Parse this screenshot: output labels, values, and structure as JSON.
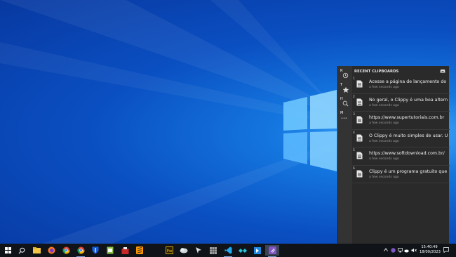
{
  "clippy": {
    "title": "RECENT CLIPBOARDS",
    "rail": [
      {
        "key": "R",
        "icon": "history-icon"
      },
      {
        "key": "T",
        "icon": "star-icon"
      },
      {
        "key": "H",
        "icon": "search-icon"
      },
      {
        "key": "M",
        "icon": "more-icon",
        "more": "•••"
      }
    ],
    "items": [
      {
        "num": "1",
        "text": "Acesse a página de lançamento do Cli",
        "time": "a few seconds ago"
      },
      {
        "num": "2",
        "text": "No geral, o Clippy é uma boa alternati",
        "time": "a few seconds ago"
      },
      {
        "num": "3",
        "text": "https://www.supertutoriais.com.br",
        "time": "a few seconds ago"
      },
      {
        "num": "4",
        "text": "O Clippy é muito simples de usar. Uma",
        "time": "a few seconds ago"
      },
      {
        "num": "5",
        "text": "https://www.softdownload.com.br/",
        "time": "a few seconds ago"
      },
      {
        "num": "6",
        "text": "Clippy é um programa gratuito que ofe",
        "time": "a few seconds ago"
      }
    ]
  },
  "taskbar": {
    "time": "15:40:49",
    "date": "18/09/2023",
    "apps": [
      "start-icon",
      "search-icon",
      "file-explorer-icon",
      "firefox-icon",
      "chrome-icon",
      "chrome-alt-icon",
      "bitwarden-icon",
      "notepad-icon",
      "app-red-icon",
      "sublime-icon",
      "dreamweaver-icon",
      "app-cloud-icon",
      "app-cursor-icon",
      "app-grid-icon",
      "vscode-icon",
      "app-teal-icon",
      "app-blue-icon",
      "clippy-icon"
    ]
  },
  "colors": {
    "accent": "#0a55c9",
    "panel": "#2a2a2a",
    "taskbar": "#101418"
  }
}
